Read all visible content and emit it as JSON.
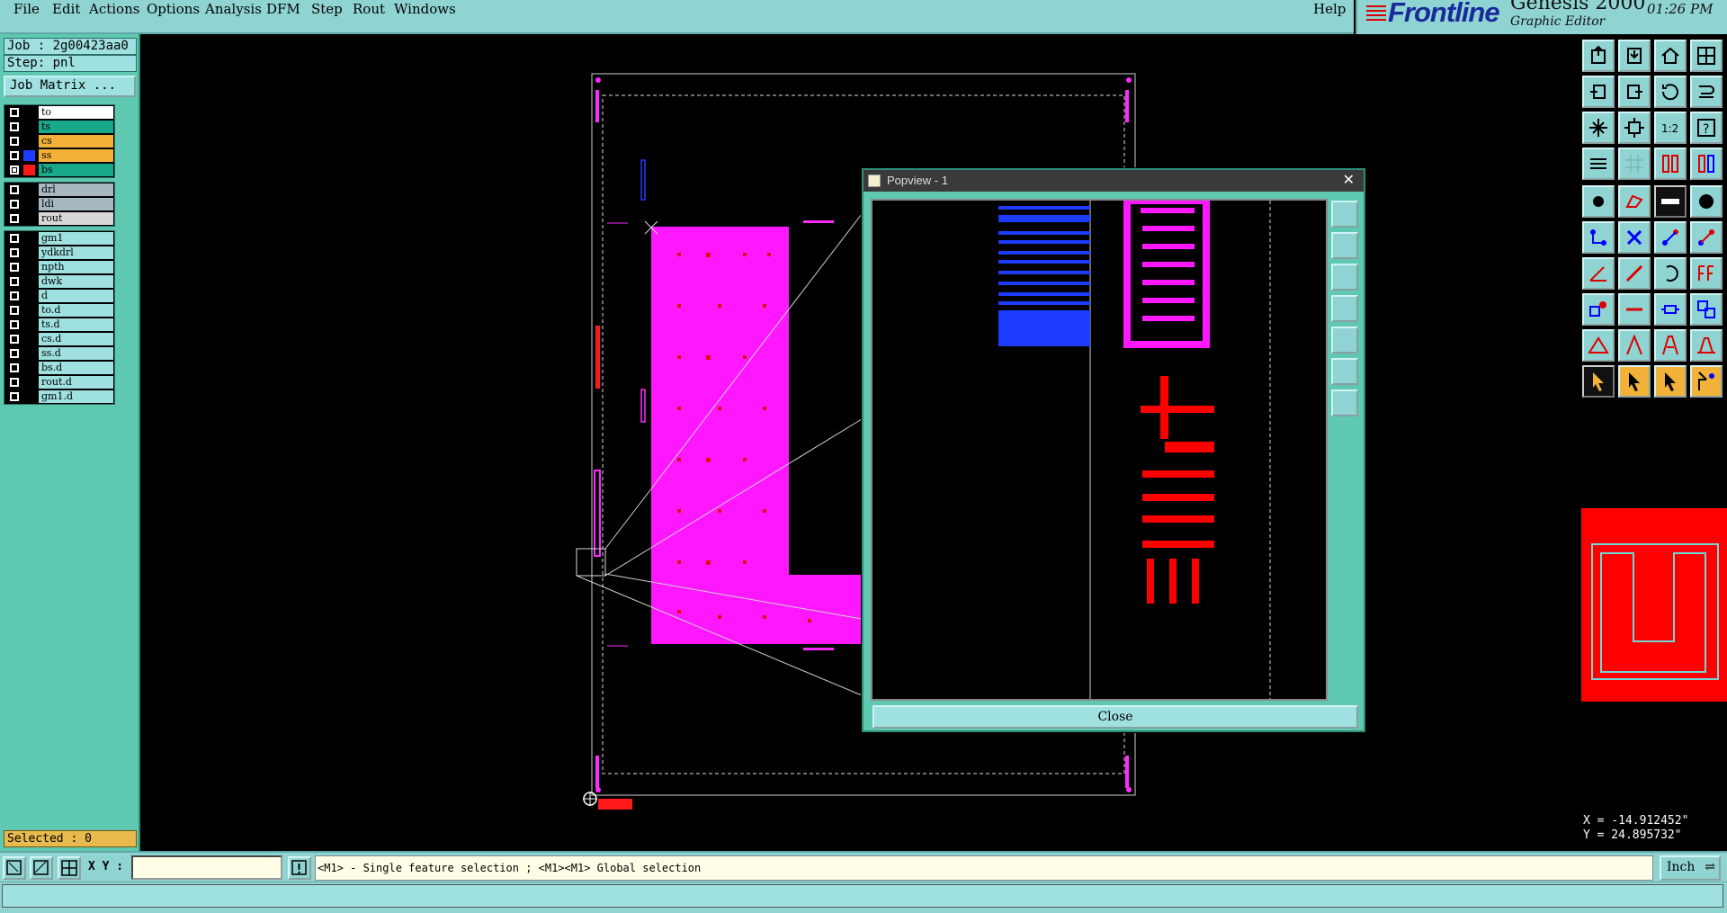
{
  "menu": [
    "File",
    "Edit",
    "Actions",
    "Options",
    "Analysis",
    "DFM",
    "Step",
    "Rout",
    "Windows"
  ],
  "help": "Help",
  "brand": {
    "logo": "Frontline",
    "app": "Genesis 2000",
    "subtitle": "Graphic Editor",
    "time": "01:26 PM"
  },
  "job": {
    "job_line": "Job : 2g00423aa0",
    "step_line": "Step: pnl",
    "matrix_button": "Job Matrix ..."
  },
  "layers_board": [
    {
      "name": "to",
      "color": "#ffffff",
      "swatch": "#000000",
      "checked": false
    },
    {
      "name": "ts",
      "color": "#1aa88a",
      "swatch": "#000000",
      "checked": false
    },
    {
      "name": "cs",
      "color": "#f2b23a",
      "swatch": "#000000",
      "checked": false
    },
    {
      "name": "ss",
      "color": "#f2b23a",
      "swatch": "#1e3cff",
      "checked": false
    },
    {
      "name": "bs",
      "color": "#1aa88a",
      "swatch": "#ff1a1a",
      "checked": true
    }
  ],
  "layers_drill": [
    {
      "name": "drl",
      "color": "#a8b8c0",
      "checked": false
    },
    {
      "name": "ldi",
      "color": "#a8b8c0",
      "checked": false
    },
    {
      "name": "rout",
      "color": "#d8d8d8",
      "checked": false
    }
  ],
  "layers_misc": [
    {
      "name": "gm1",
      "checked": false
    },
    {
      "name": "ydkdrl",
      "checked": false
    },
    {
      "name": "npth",
      "checked": false
    },
    {
      "name": "dwk",
      "checked": false
    },
    {
      "name": "d",
      "checked": false
    },
    {
      "name": "to.d",
      "checked": false
    },
    {
      "name": "ts.d",
      "checked": false
    },
    {
      "name": "cs.d",
      "checked": false
    },
    {
      "name": "ss.d",
      "checked": false
    },
    {
      "name": "bs.d",
      "checked": false
    },
    {
      "name": "rout.d",
      "checked": false
    },
    {
      "name": "gm1.d",
      "checked": false
    }
  ],
  "selected": "Selected : 0",
  "popview": {
    "title": "Popview - 1",
    "close_label": "Close"
  },
  "coords": {
    "x": "X = -14.912452\"",
    "y": "Y = 24.895732\""
  },
  "status": {
    "xy_label": "X Y :",
    "xy_value": "",
    "message": "<M1> - Single feature selection ; <M1><M1> Global selection",
    "units": "Inch"
  }
}
